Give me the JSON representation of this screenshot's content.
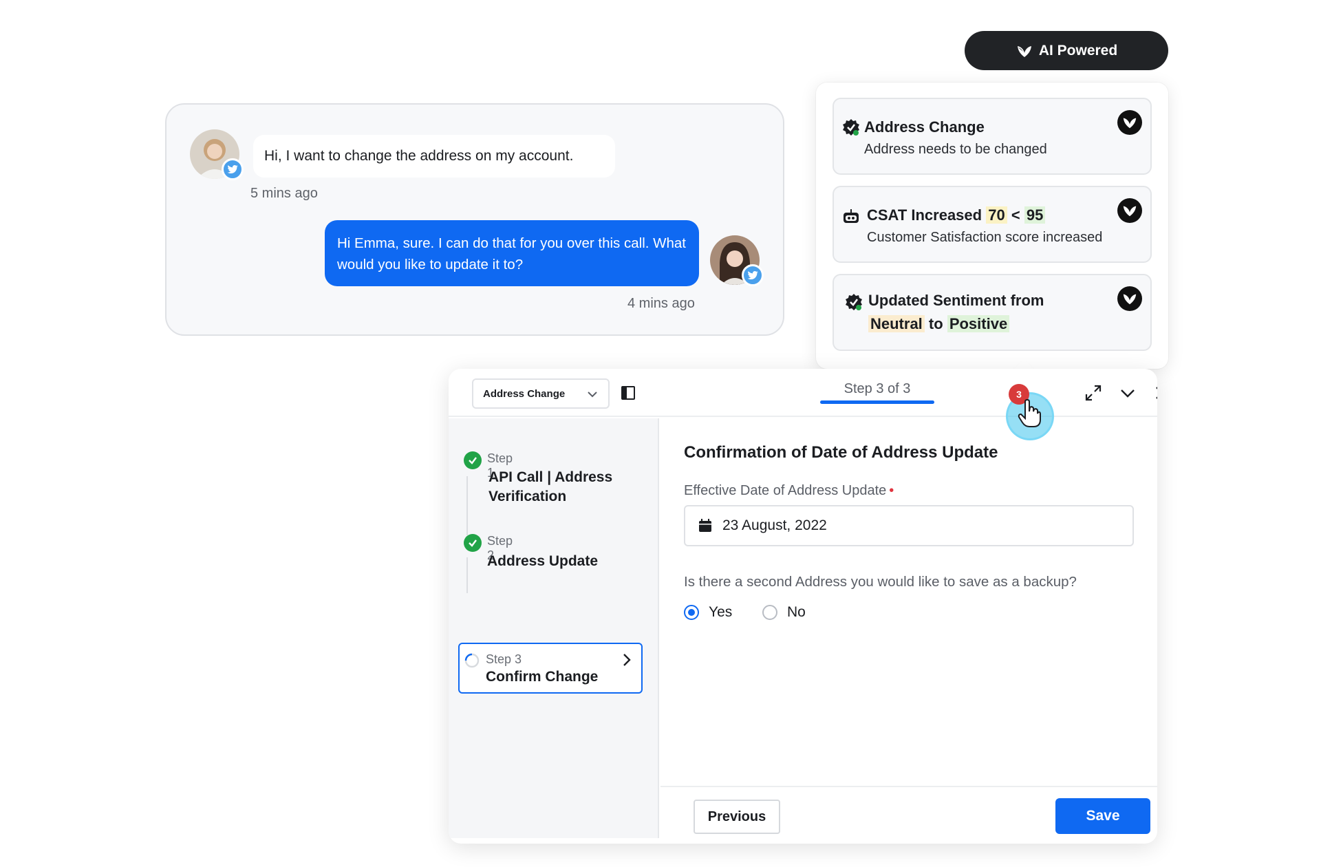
{
  "chat": {
    "incoming_message": "Hi, I want to change the address on my account.",
    "incoming_time": "5 mins ago",
    "outgoing_message": "Hi Emma, sure. I can do that for you over this call. What would you like to update it to?",
    "outgoing_time": "4 mins ago"
  },
  "ai_pill": {
    "label": "AI Powered"
  },
  "insights": {
    "cards": [
      {
        "title": "Address Change",
        "subtitle": "Address needs to be changed"
      },
      {
        "title": "CSAT Increased",
        "from": "70",
        "op": "<",
        "to": "95",
        "subtitle": "Customer Satisfaction score increased"
      },
      {
        "title": "Updated Sentiment from",
        "from": "Neutral",
        "joiner": "to",
        "to": "Positive"
      }
    ]
  },
  "workflow": {
    "select_value": "Address Change",
    "step_indicator": "Step 3 of 3",
    "notification_count": "3",
    "steps": [
      {
        "label": "Step 1",
        "name": "API Call | Address Verification",
        "status": "done"
      },
      {
        "label": "Step 2",
        "name": "Address Update",
        "status": "done"
      },
      {
        "label": "Step 3",
        "name": "Confirm Change",
        "status": "active"
      }
    ],
    "main": {
      "title": "Confirmation of Date of Address Update",
      "field_label": "Effective Date of Address Update",
      "date_value": "23 August, 2022",
      "question": "Is there a second Address you would like to save as a backup?",
      "options": [
        "Yes",
        "No"
      ],
      "selected": "Yes"
    },
    "buttons": {
      "previous": "Previous",
      "save": "Save"
    }
  },
  "colors": {
    "accent": "#0f69f2",
    "success": "#21a347",
    "badge": "#d83b3b",
    "dark": "#212326"
  },
  "icons": [
    "twitter-icon",
    "ai-bloom-icon",
    "check-badge-icon",
    "bot-icon",
    "chevron-down-icon",
    "side-panel-icon",
    "expand-icon",
    "close-icon",
    "calendar-icon",
    "spinner-icon",
    "chevron-right-icon",
    "hand-cursor-icon"
  ]
}
